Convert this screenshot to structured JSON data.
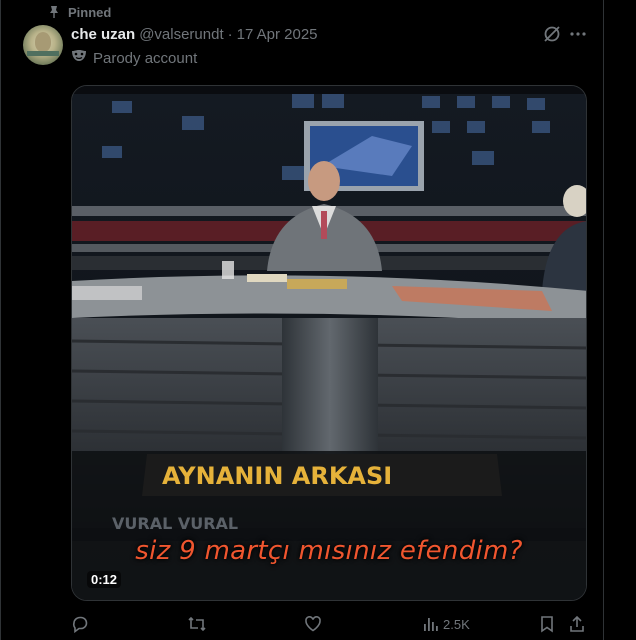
{
  "pinned": {
    "label": "Pinned"
  },
  "tweet": {
    "display_name": "che uzan",
    "handle": "@valserundt",
    "separator": "·",
    "date": "17 Apr 2025",
    "parody_label": "Parody account"
  },
  "media": {
    "caption": "siz 9 martçı mısınız efendim?",
    "time": "0:12",
    "banner_text": "AYNANIN ARKASI",
    "lower_text": "VURAL VURAL"
  },
  "actions": {
    "views": "2.5K"
  },
  "icons": {
    "pin": "pin-icon",
    "grok": "grok-icon",
    "more": "more-icon",
    "reply": "reply-icon",
    "retweet": "retweet-icon",
    "like": "like-icon",
    "views": "views-icon",
    "bookmark": "bookmark-icon",
    "share": "share-icon",
    "parody": "parody-mask-icon"
  },
  "colors": {
    "background": "#000000",
    "muted": "#71767b",
    "text": "#e7e9ea",
    "caption": "#f0562f"
  }
}
